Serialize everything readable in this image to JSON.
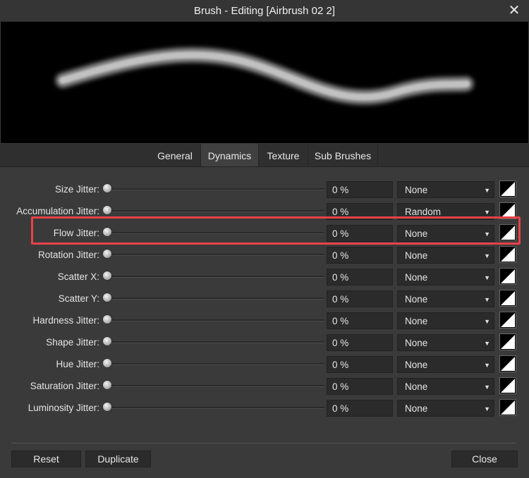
{
  "window": {
    "title": "Brush - Editing [Airbrush 02 2]",
    "close_icon": "close-icon"
  },
  "tabs": [
    {
      "label": "General",
      "active": false
    },
    {
      "label": "Dynamics",
      "active": true
    },
    {
      "label": "Texture",
      "active": false
    },
    {
      "label": "Sub Brushes",
      "active": false
    }
  ],
  "rows": [
    {
      "label": "Size Jitter:",
      "value": "0 %",
      "controller": "None"
    },
    {
      "label": "Accumulation Jitter:",
      "value": "0 %",
      "controller": "Random"
    },
    {
      "label": "Flow Jitter:",
      "value": "0 %",
      "controller": "None"
    },
    {
      "label": "Rotation Jitter:",
      "value": "0 %",
      "controller": "None"
    },
    {
      "label": "Scatter X:",
      "value": "0 %",
      "controller": "None"
    },
    {
      "label": "Scatter Y:",
      "value": "0 %",
      "controller": "None"
    },
    {
      "label": "Hardness Jitter:",
      "value": "0 %",
      "controller": "None"
    },
    {
      "label": "Shape Jitter:",
      "value": "0 %",
      "controller": "None"
    },
    {
      "label": "Hue Jitter:",
      "value": "0 %",
      "controller": "None"
    },
    {
      "label": "Saturation Jitter:",
      "value": "0 %",
      "controller": "None"
    },
    {
      "label": "Luminosity Jitter:",
      "value": "0 %",
      "controller": "None"
    }
  ],
  "footer": {
    "reset_label": "Reset",
    "duplicate_label": "Duplicate",
    "close_label": "Close"
  },
  "colors": {
    "highlight": "#e8424a",
    "background": "#3a3a3a",
    "field": "#2b2b2b"
  }
}
